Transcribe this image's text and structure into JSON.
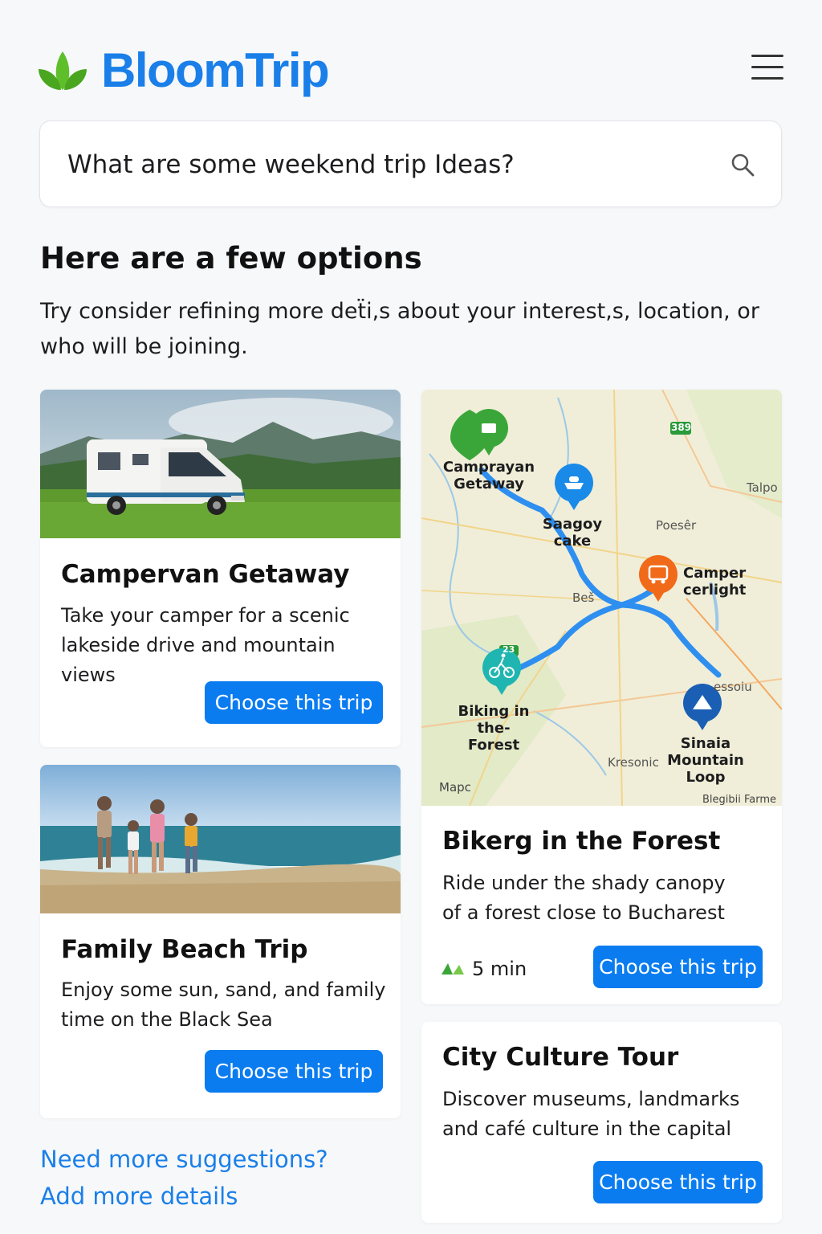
{
  "app": {
    "name": "BloomTrip",
    "logo_icon": "leaf-icon",
    "accent": "#1a7fe8",
    "button_color": "#0a7cf0"
  },
  "header": {
    "menu_icon": "hamburger-menu-icon"
  },
  "search": {
    "value": "What are some weekend trip Ideas?",
    "icon": "search-icon"
  },
  "results": {
    "heading": "Here are a few options",
    "subtext": "Try consider refining more deẗi,s about your interest,s, location, or who will be joining."
  },
  "cards": [
    {
      "title": "Campervan Getaway",
      "description": "Take your camper for a scenic lakeside drive and mountain views",
      "button": "Choose this trip",
      "image": "campervan-photo"
    },
    {
      "title": "Family Beach Trip",
      "description": "Enjoy some sun, sand, and family time on the Black Sea",
      "button": "Choose this trip",
      "image": "beach-photo"
    },
    {
      "title": "Bikerg in the Forest",
      "description": "Ride under the shady canopy of a forest close to Bucharest",
      "button": "Choose this trip",
      "duration": "5 min",
      "duration_icon": "route-icon"
    },
    {
      "title": "City Culture Tour",
      "description": "Discover museums, landmarks and café culture in the capital",
      "button": "Choose this trip"
    }
  ],
  "map": {
    "pins": [
      {
        "label": "Camprayan Getaway",
        "icon": "campsite-icon",
        "color": "#3aa63a"
      },
      {
        "label": "Saagoy cake",
        "icon": "boat-icon",
        "color": "#1a8ae8"
      },
      {
        "label": "Camper cerlight",
        "icon": "camper-icon",
        "color": "#f06a1a"
      },
      {
        "label": "Biking in the-Forest",
        "icon": "bicycle-icon",
        "color": "#1fb5b0"
      },
      {
        "label": "Sinaia Mountain Loop",
        "icon": "mountain-icon",
        "color": "#1a5fb4"
      }
    ],
    "place_labels": [
      "Talpo",
      "Poesêr",
      "Beš",
      "essoiu",
      "Kresonic"
    ],
    "road_badges": [
      "389",
      "23"
    ],
    "attribution": "Mapc",
    "credit": "Blegibii Farme"
  },
  "footer": {
    "more_suggestions": "Need more suggestions?",
    "add_details": "Add more details"
  }
}
